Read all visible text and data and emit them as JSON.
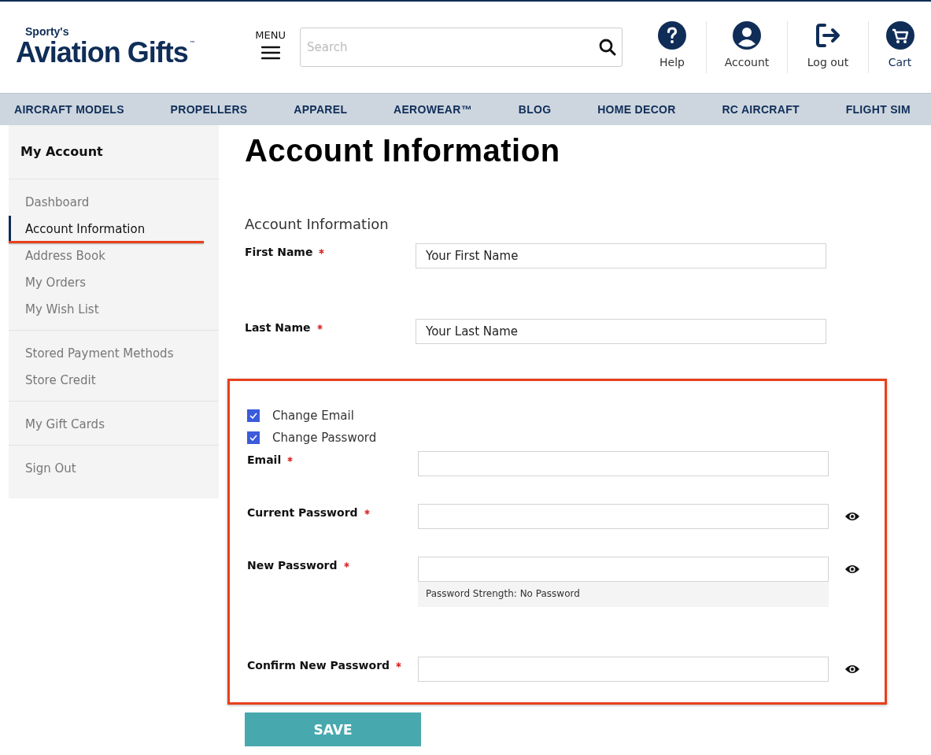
{
  "header": {
    "logo": {
      "tagline": "Sporty's",
      "name": "Aviation Gifts",
      "trademark": "™"
    },
    "menu_label": "MENU",
    "search": {
      "placeholder": "Search"
    },
    "actions": [
      {
        "kind": "help",
        "label": "Help"
      },
      {
        "kind": "account",
        "label": "Account"
      },
      {
        "kind": "logout",
        "label": "Log out"
      },
      {
        "kind": "cart",
        "label": "Cart"
      }
    ]
  },
  "nav": [
    "AIRCRAFT MODELS",
    "PROPELLERS",
    "APPAREL",
    "AEROWEAR™",
    "BLOG",
    "HOME DECOR",
    "RC AIRCRAFT",
    "FLIGHT SIM"
  ],
  "sidebar": {
    "title": "My Account",
    "groups": [
      [
        {
          "label": "Dashboard",
          "selected": false,
          "highlighted": false
        },
        {
          "label": "Account Information",
          "selected": true,
          "highlighted": true
        },
        {
          "label": "Address Book",
          "selected": false,
          "highlighted": false
        },
        {
          "label": "My Orders",
          "selected": false,
          "highlighted": false
        },
        {
          "label": "My Wish List",
          "selected": false,
          "highlighted": false
        }
      ],
      [
        {
          "label": "Stored Payment Methods",
          "selected": false,
          "highlighted": false
        },
        {
          "label": "Store Credit",
          "selected": false,
          "highlighted": false
        }
      ],
      [
        {
          "label": "My Gift Cards",
          "selected": false,
          "highlighted": false
        }
      ],
      [
        {
          "label": "Sign Out",
          "selected": false,
          "highlighted": false
        }
      ]
    ]
  },
  "main": {
    "title": "Account Information",
    "section_title": "Account Information",
    "name_fields": [
      {
        "label": "First Name",
        "required": true,
        "value": "Your First Name"
      },
      {
        "label": "Last Name",
        "required": true,
        "value": "Your Last Name"
      }
    ],
    "credentials": {
      "highlighted": true,
      "options": [
        {
          "label": "Change Email",
          "checked": true
        },
        {
          "label": "Change Password",
          "checked": true
        }
      ],
      "fields": [
        {
          "kind": "text",
          "label": "Email",
          "required": true
        },
        {
          "kind": "password",
          "label": "Current Password",
          "required": true
        },
        {
          "kind": "password",
          "label": "New Password",
          "required": true,
          "strength": "Password Strength: No Password"
        },
        {
          "kind": "password",
          "label": "Confirm New Password",
          "required": true
        }
      ]
    },
    "save_label": "SAVE"
  }
}
